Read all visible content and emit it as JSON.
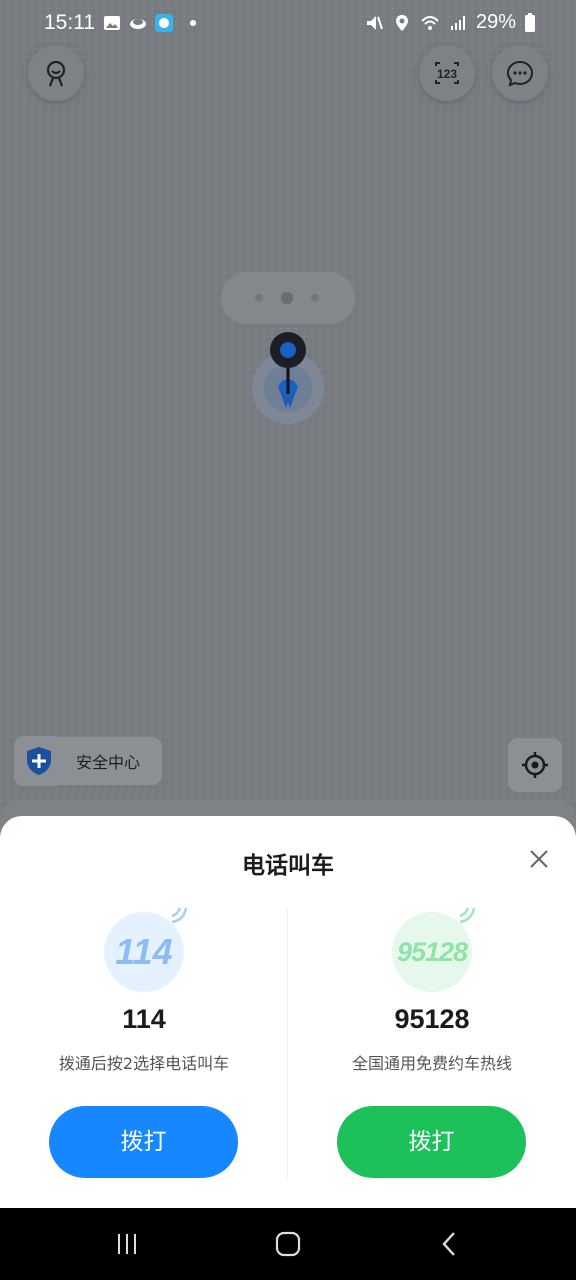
{
  "status_bar": {
    "time": "15:11",
    "battery": "29%",
    "left_icons": [
      "gallery-icon",
      "cloud-icon",
      "app-icon",
      "dot-icon"
    ],
    "right_icons": [
      "mute-icon",
      "location-icon",
      "wifi-icon",
      "signal-icon",
      "battery-icon"
    ]
  },
  "top_buttons": {
    "profile_icon": "avatar-icon",
    "keyboard_icon": "number-keypad-icon",
    "keyboard_label": "123",
    "messages_icon": "chat-bubble-icon"
  },
  "map": {
    "safety_label": "安全中心",
    "safety_icon": "shield-plus-icon",
    "locate_icon": "locate-target-icon"
  },
  "dialog": {
    "title": "电话叫车",
    "close_icon": "close-icon",
    "options": [
      {
        "badge": "114",
        "number": "114",
        "description": "拨通后按2选择电话叫车",
        "button_label": "拨打",
        "accent": "#1687ff",
        "badge_bg": "#e6f1ff",
        "badge_text_color": "#8dbcf4"
      },
      {
        "badge": "95128",
        "number": "95128",
        "description": "全国通用免费约车热线",
        "button_label": "拨打",
        "accent": "#1cc15a",
        "badge_bg": "#e6f8ec",
        "badge_text_color": "#8ee3a6"
      }
    ]
  },
  "nav_bar": {
    "recents_icon": "recents-icon",
    "home_icon": "home-icon",
    "back_icon": "back-icon"
  }
}
